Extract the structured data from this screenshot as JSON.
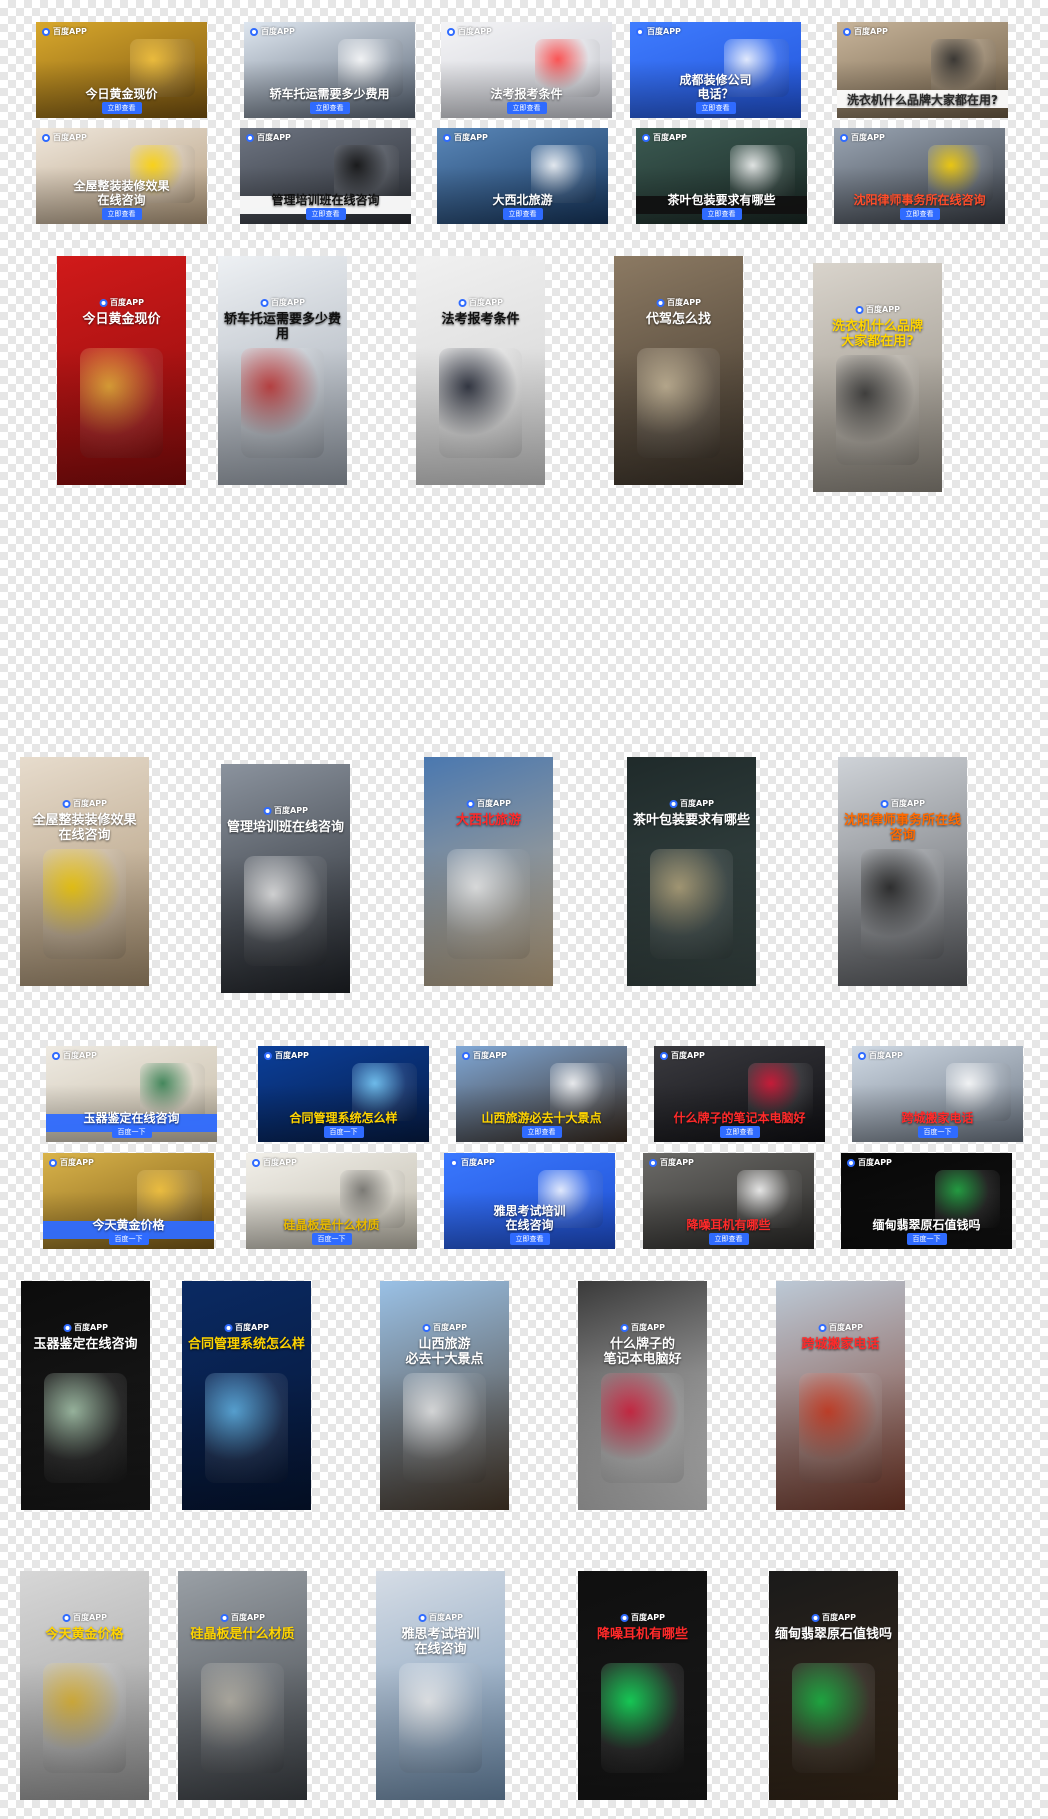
{
  "brand": "百度APP",
  "tiles": [
    {
      "id": "h1",
      "headline": "今日黄金现价",
      "cta": "立即查看",
      "hcolor": "#ffffff",
      "bg": [
        "#d8a82c",
        "#7a5410"
      ],
      "bar": "",
      "accent": "#f5c542"
    },
    {
      "id": "h2",
      "headline": "轿车托运需要多少费用",
      "cta": "立即查看",
      "hcolor": "#ffffff",
      "bg": [
        "#dfe7f0",
        "#5a6676"
      ],
      "bar": "",
      "accent": "#ffffff"
    },
    {
      "id": "h3",
      "headline": "法考报考条件",
      "cta": "立即查看",
      "hcolor": "#ffffff",
      "bg": [
        "#f4f4f6",
        "#c9cbd3"
      ],
      "bar": "",
      "accent": "#ff3b3b"
    },
    {
      "id": "h4",
      "headline": "成都装修公司\n电话？",
      "cta": "立即查看",
      "hcolor": "#ffffff",
      "bg": [
        "#3f7cff",
        "#2254d8"
      ],
      "bar": "",
      "accent": "#ffffff"
    },
    {
      "id": "h5",
      "headline": "洗衣机什么品牌大家都在用?",
      "cta": "",
      "hcolor": "#2a2a2a",
      "bg": [
        "#c7b49a",
        "#6d5c45"
      ],
      "bar": "#ffffff",
      "accent": "#2a2a2a"
    },
    {
      "id": "h6",
      "headline": "全屋整装装修效果\n在线咨询",
      "cta": "立即查看",
      "hcolor": "#ffffff",
      "bg": [
        "#efe7dc",
        "#b39b7c"
      ],
      "bar": "",
      "accent": "#ffd400"
    },
    {
      "id": "h7",
      "headline": "管理培训班在线咨询",
      "cta": "立即查看",
      "hcolor": "#111111",
      "bg": [
        "#6e7582",
        "#2a2d33"
      ],
      "bar": "#ffffff",
      "accent": "#111111"
    },
    {
      "id": "h8",
      "headline": "大西北旅游",
      "cta": "立即查看",
      "hcolor": "#ffffff",
      "bg": [
        "#5a87b8",
        "#16365e"
      ],
      "bar": "",
      "accent": "#ffffff"
    },
    {
      "id": "h9",
      "headline": "茶叶包装要求有哪些",
      "cta": "立即查看",
      "hcolor": "#ffffff",
      "bg": [
        "#3b5a52",
        "#1a2824"
      ],
      "bar": "#111111",
      "accent": "#ffffff"
    },
    {
      "id": "h10",
      "headline": "沈阳律师事务所在线咨询",
      "cta": "立即查看",
      "hcolor": "#ff4d2a",
      "bg": [
        "#9aa5b3",
        "#3a3f47"
      ],
      "bar": "",
      "accent": "#ffd400"
    },
    {
      "id": "v1",
      "headline": "今日黄金现价",
      "cta": "",
      "hcolor": "#ffffff",
      "bg": [
        "#d11a1a",
        "#8a0c0c"
      ],
      "bar": "",
      "accent": "#f5c542"
    },
    {
      "id": "v2",
      "headline": "轿车托运需要多少费用",
      "cta": "",
      "hcolor": "#111111",
      "bg": [
        "#eef1f4",
        "#9aa2ad"
      ],
      "bar": "",
      "accent": "#c83030"
    },
    {
      "id": "v3",
      "headline": "法考报考条件",
      "cta": "",
      "hcolor": "#111111",
      "bg": [
        "#f1f1f1",
        "#cfcfcf"
      ],
      "bar": "",
      "accent": "#1a1f2e"
    },
    {
      "id": "v4",
      "headline": "代驾怎么找",
      "cta": "",
      "hcolor": "#ffffff",
      "bg": [
        "#8c7a63",
        "#3d342a"
      ],
      "bar": "",
      "accent": "#d8c8a8"
    },
    {
      "id": "v5",
      "headline": "洗衣机什么品牌\n大家都在用?",
      "cta": "",
      "hcolor": "#ffd400",
      "bg": [
        "#d9d4cc",
        "#8f897f"
      ],
      "bar": "",
      "accent": "#333333"
    },
    {
      "id": "v6",
      "headline": "全屋整装装修效果\n在线咨询",
      "cta": "",
      "hcolor": "#ffffff",
      "bg": [
        "#e7dccd",
        "#a8906f"
      ],
      "bar": "",
      "accent": "#ffd400"
    },
    {
      "id": "v7",
      "headline": "管理培训班在线咨询",
      "cta": "",
      "hcolor": "#ffffff",
      "bg": [
        "#8b939e",
        "#1f2227"
      ],
      "bar": "",
      "accent": "#ffffff"
    },
    {
      "id": "v8",
      "headline": "大西北旅游",
      "cta": "",
      "hcolor": "#ff2a2a",
      "bg": [
        "#4a78b0",
        "#c9b08a"
      ],
      "bar": "",
      "accent": "#ffffff"
    },
    {
      "id": "v9",
      "headline": "茶叶包装要求有哪些",
      "cta": "",
      "hcolor": "#ffffff",
      "bg": [
        "#1f2a2a",
        "#3c4b49"
      ],
      "bar": "",
      "accent": "#c8b78a"
    },
    {
      "id": "v10",
      "headline": "沈阳律师事务所在线咨询",
      "cta": "",
      "hcolor": "#ff6a00",
      "bg": [
        "#cfd3d8",
        "#5a5c60"
      ],
      "bar": "",
      "accent": "#222222"
    },
    {
      "id": "h11",
      "headline": "玉器鉴定在线咨询",
      "cta": "百度一下",
      "hcolor": "#ffffff",
      "bg": [
        "#eeeae2",
        "#c6bba6"
      ],
      "bar": "#2f6bff",
      "accent": "#2a7a4a"
    },
    {
      "id": "h12",
      "headline": "合同管理系统怎么样",
      "cta": "百度一下",
      "hcolor": "#ffd400",
      "bg": [
        "#0b3f9a",
        "#061c46"
      ],
      "bar": "",
      "accent": "#7fd3ff"
    },
    {
      "id": "h13",
      "headline": "山西旅游必去十大景点",
      "cta": "立即查看",
      "hcolor": "#ffd400",
      "bg": [
        "#7fa7d6",
        "#3a2c20"
      ],
      "bar": "",
      "accent": "#ffffff"
    },
    {
      "id": "h14",
      "headline": "什么牌子的笔记本电脑好",
      "cta": "立即查看",
      "hcolor": "#ff2a2a",
      "bg": [
        "#3a3a3f",
        "#101014"
      ],
      "bar": "",
      "accent": "#e11a3b"
    },
    {
      "id": "h15",
      "headline": "跨城搬家电话",
      "cta": "百度一下",
      "hcolor": "#ff2a2a",
      "bg": [
        "#cfd9e4",
        "#6d7784"
      ],
      "bar": "",
      "accent": "#ffffff"
    },
    {
      "id": "h16",
      "headline": "今天黄金价格",
      "cta": "百度一下",
      "hcolor": "#ffffff",
      "bg": [
        "#d9b34a",
        "#7b5a17"
      ],
      "bar": "#2f6bff",
      "accent": "#f5c542"
    },
    {
      "id": "h17",
      "headline": "硅晶板是什么材质",
      "cta": "百度一下",
      "hcolor": "#e6b800",
      "bg": [
        "#f2f0ea",
        "#bdb8aa"
      ],
      "bar": "",
      "accent": "#6b6a66"
    },
    {
      "id": "h18",
      "headline": "雅思考试培训\n在线咨询",
      "cta": "立即查看",
      "hcolor": "#ffffff",
      "bg": [
        "#3a78ff",
        "#1f4fd0"
      ],
      "bar": "",
      "accent": "#ffffff"
    },
    {
      "id": "h19",
      "headline": "降噪耳机有哪些",
      "cta": "立即查看",
      "hcolor": "#ff2a2a",
      "bg": [
        "#6b6a67",
        "#2b2a28"
      ],
      "bar": "",
      "accent": "#ffffff"
    },
    {
      "id": "h20",
      "headline": "缅甸翡翠原石值钱吗",
      "cta": "百度一下",
      "hcolor": "#ffffff",
      "bg": [
        "#070707",
        "#121212"
      ],
      "bar": "",
      "accent": "#27b34a"
    },
    {
      "id": "v11",
      "headline": "玉器鉴定在线咨询",
      "cta": "",
      "hcolor": "#ffffff",
      "bg": [
        "#0c0c0c",
        "#1b1b1b"
      ],
      "bar": "",
      "accent": "#bfe3c6"
    },
    {
      "id": "v12",
      "headline": "合同管理系统怎么样",
      "cta": "",
      "hcolor": "#ffd400",
      "bg": [
        "#0a2a63",
        "#061533"
      ],
      "bar": "",
      "accent": "#6ec9ff"
    },
    {
      "id": "v13",
      "headline": "山西旅游\n必去十大景点",
      "cta": "",
      "hcolor": "#ffffff",
      "bg": [
        "#9ac1e6",
        "#4a3a2a"
      ],
      "bar": "",
      "accent": "#ffffff"
    },
    {
      "id": "v14",
      "headline": "什么牌子的\n笔记本电脑好",
      "cta": "",
      "hcolor": "#ffffff",
      "bg": [
        "#3a3a3a",
        "#dcdcdc"
      ],
      "bar": "",
      "accent": "#e11a3b"
    },
    {
      "id": "v15",
      "headline": "跨城搬家电话",
      "cta": "",
      "hcolor": "#ff2a2a",
      "bg": [
        "#bcc9d6",
        "#7b3b2a"
      ],
      "bar": "",
      "accent": "#d83a1f"
    },
    {
      "id": "v16",
      "headline": "今天黄金价格",
      "cta": "",
      "hcolor": "#ffd400",
      "bg": [
        "#d7d7d7",
        "#9a9a9a"
      ],
      "bar": "",
      "accent": "#e6b82a"
    },
    {
      "id": "v17",
      "headline": "硅晶板是什么材质",
      "cta": "",
      "hcolor": "#ffd400",
      "bg": [
        "#9aa0a6",
        "#3d4146"
      ],
      "bar": "",
      "accent": "#c7c2b5"
    },
    {
      "id": "v18",
      "headline": "雅思考试培训\n在线咨询",
      "cta": "",
      "hcolor": "#ffffff",
      "bg": [
        "#d6dde6",
        "#6f8fb0"
      ],
      "bar": "",
      "accent": "#ffffff"
    },
    {
      "id": "v19",
      "headline": "降噪耳机有哪些",
      "cta": "",
      "hcolor": "#ff2a2a",
      "bg": [
        "#0f0f0f",
        "#1a1a1a"
      ],
      "bar": "",
      "accent": "#19ff6a"
    },
    {
      "id": "v20",
      "headline": "缅甸翡翠原石值钱吗",
      "cta": "",
      "hcolor": "#ffffff",
      "bg": [
        "#1a1a1a",
        "#3a2a1a"
      ],
      "bar": "",
      "accent": "#1fcf4e"
    }
  ]
}
